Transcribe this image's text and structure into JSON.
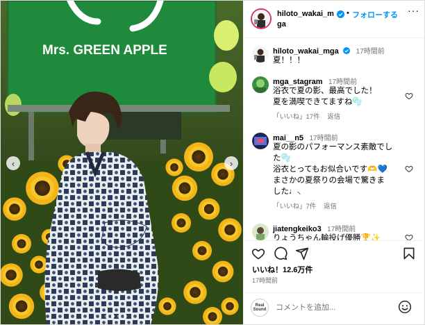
{
  "post": {
    "author": "hiloto_wakai_mga",
    "follow_label": "フォローする",
    "separator": "•",
    "more_label": "···",
    "caption_user": "hiloto_wakai_mga",
    "caption_time": "17時間前",
    "caption_text": "夏！！！",
    "likes": "いいね！12.6万件",
    "time": "17時間前",
    "add_comment_placeholder": "コメントを追加...",
    "logo_text_1": "Real",
    "logo_text_2": "Sound"
  },
  "photo": {
    "banner_text": "Mrs. GREEN APPLE",
    "nav_prev": "‹",
    "nav_next": "›",
    "slides": 4,
    "active_slide": 1
  },
  "comments": [
    {
      "user": "mga_stagram",
      "time": "17時間前",
      "lines": [
        "浴衣で夏の影、最高でした！",
        "夏を満喫できてますね🫧"
      ],
      "likes": "「いいね」17件",
      "reply": "返信"
    },
    {
      "user": "mai__n5",
      "time": "17時間前",
      "lines": [
        "夏の影のパフォーマンス素敵でし",
        "た🫧",
        "浴衣とってもお似合いです🫶💙",
        "まさかの夏祭りの会場で驚きま",
        "した♩⸜"
      ],
      "likes": "「いいね」7件",
      "reply": "返信"
    },
    {
      "user": "jiatengkeiko3",
      "time": "17時間前",
      "lines": [
        "りょうちゃん輪投げ優勝🏆✨"
      ],
      "likes": "",
      "reply": ""
    }
  ],
  "icons": {
    "heart": "heart-icon",
    "comment": "comment-icon",
    "share": "share-icon",
    "bookmark": "bookmark-icon",
    "emoji": "emoji-icon",
    "verified": "verified-badge-icon"
  },
  "colors": {
    "link_blue": "#0095f6",
    "verified_blue": "#0095f6",
    "muted": "#737373",
    "banner_green": "#1f8a3c"
  }
}
